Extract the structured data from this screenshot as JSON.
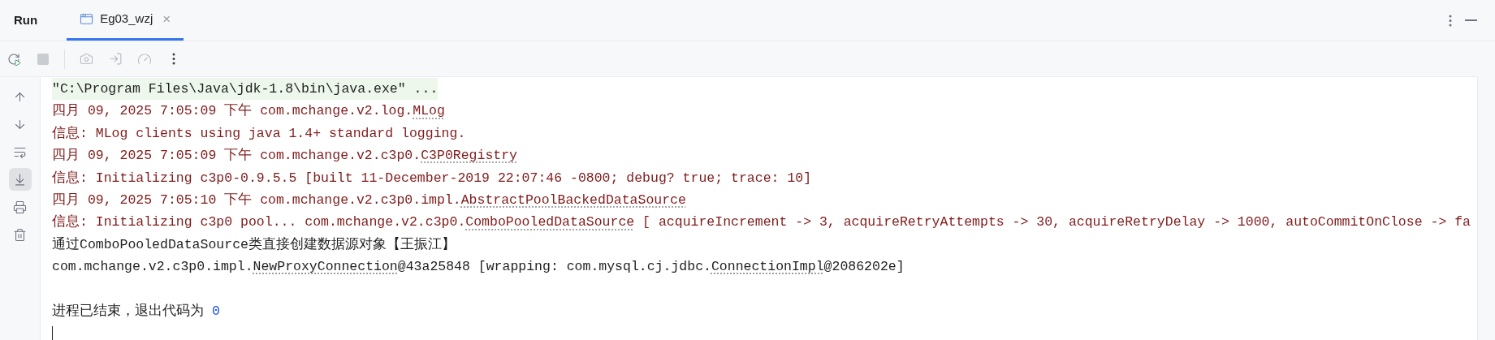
{
  "panel": {
    "title": "Run"
  },
  "tabs": [
    {
      "label": "Eg03_wzj",
      "selected": true,
      "close": "×"
    }
  ],
  "toolbar": [
    {
      "kind": "rerun",
      "disabled": false
    },
    {
      "kind": "stop",
      "disabled": true
    },
    {
      "kind": "separator"
    },
    {
      "kind": "camera",
      "disabled": true
    },
    {
      "kind": "attach",
      "disabled": true
    },
    {
      "kind": "profiler",
      "disabled": true
    },
    {
      "kind": "more",
      "disabled": false
    }
  ],
  "gutter": [
    {
      "kind": "up",
      "selected": false
    },
    {
      "kind": "down",
      "selected": false
    },
    {
      "kind": "wrap",
      "selected": false
    },
    {
      "kind": "scroll-end",
      "selected": true
    },
    {
      "kind": "print",
      "selected": false
    },
    {
      "kind": "clear",
      "selected": false
    }
  ],
  "console": [
    {
      "kind": "command",
      "segments": [
        {
          "text": "\"C:\\Program Files\\Java\\jdk-1.8\\bin\\java.exe\" ...",
          "link": false
        }
      ]
    },
    {
      "kind": "stderr",
      "segments": [
        {
          "text": "四月 09, 2025 7:05:09 下午 com.mchange.v2.log.",
          "link": false
        },
        {
          "text": "MLog",
          "link": true
        }
      ]
    },
    {
      "kind": "stderr",
      "segments": [
        {
          "text": "信息: MLog clients using java 1.4+ standard logging.",
          "link": false
        }
      ]
    },
    {
      "kind": "stderr",
      "segments": [
        {
          "text": "四月 09, 2025 7:05:09 下午 com.mchange.v2.c3p0.",
          "link": false
        },
        {
          "text": "C3P0Registry",
          "link": true
        }
      ]
    },
    {
      "kind": "stderr",
      "segments": [
        {
          "text": "信息: Initializing c3p0-0.9.5.5 [built 11-December-2019 22:07:46 -0800; debug? true; trace: 10]",
          "link": false
        }
      ]
    },
    {
      "kind": "stderr",
      "segments": [
        {
          "text": "四月 09, 2025 7:05:10 下午 com.mchange.v2.c3p0.impl.",
          "link": false
        },
        {
          "text": "AbstractPoolBackedDataSource",
          "link": true
        }
      ]
    },
    {
      "kind": "stderr",
      "segments": [
        {
          "text": "信息: Initializing c3p0 pool... com.mchange.v2.c3p0.",
          "link": false
        },
        {
          "text": "ComboPooledDataSource",
          "link": true
        },
        {
          "text": " [ acquireIncrement -> 3, acquireRetryAttempts -> 30, acquireRetryDelay -> 1000, autoCommitOnClose -> fa",
          "link": false
        }
      ]
    },
    {
      "kind": "stdout",
      "segments": [
        {
          "text": "通过ComboPooledDataSource类直接创建数据源对象【王振江】",
          "link": false
        }
      ]
    },
    {
      "kind": "stdout",
      "segments": [
        {
          "text": "com.mchange.v2.c3p0.impl.",
          "link": false
        },
        {
          "text": "NewProxyConnection",
          "link": true
        },
        {
          "text": "@43a25848 [wrapping: com.mysql.cj.jdbc.",
          "link": false
        },
        {
          "text": "ConnectionImpl",
          "link": true
        },
        {
          "text": "@2086202e]",
          "link": false
        }
      ]
    },
    {
      "kind": "blank"
    },
    {
      "kind": "exit",
      "segments": [
        {
          "text": "进程已结束，退出代码为 ",
          "link": false
        },
        {
          "text": "0",
          "link": false,
          "kind": "code"
        }
      ]
    }
  ]
}
